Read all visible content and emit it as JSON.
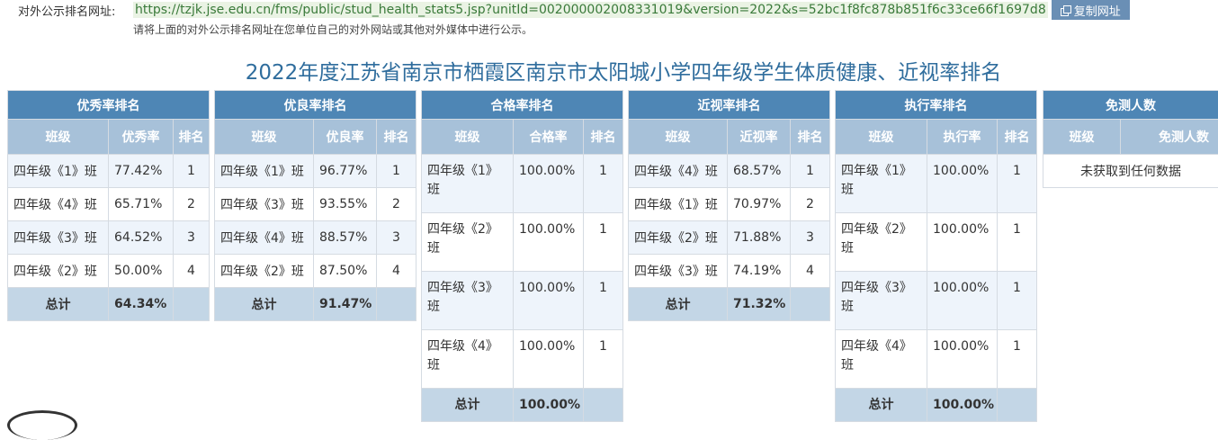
{
  "url_row": {
    "label": "对外公示排名网址:",
    "url": "https://tzjk.jse.edu.cn/fms/public/stud_health_stats5.jsp?unitId=002000002008331019&version=2022&s=52bc1f8fc878b851f6c33ce66f1697d8",
    "copy_button": "复制网址",
    "hint": "请将上面的对外公示排名网址在您单位自己的对外网站或其他对外媒体中进行公示。"
  },
  "title": "2022年度江苏省南京市栖霞区南京市太阳城小学四年级学生体质健康、近视率排名",
  "tables": {
    "excellent": {
      "caption": "优秀率排名",
      "headers": [
        "班级",
        "优秀率",
        "排名"
      ],
      "rows": [
        [
          "四年级《1》班",
          "77.42%",
          "1"
        ],
        [
          "四年级《4》班",
          "65.71%",
          "2"
        ],
        [
          "四年级《3》班",
          "64.52%",
          "3"
        ],
        [
          "四年级《2》班",
          "50.00%",
          "4"
        ]
      ],
      "total_label": "总计",
      "total_value": "64.34%"
    },
    "good": {
      "caption": "优良率排名",
      "headers": [
        "班级",
        "优良率",
        "排名"
      ],
      "rows": [
        [
          "四年级《1》班",
          "96.77%",
          "1"
        ],
        [
          "四年级《3》班",
          "93.55%",
          "2"
        ],
        [
          "四年级《4》班",
          "88.57%",
          "3"
        ],
        [
          "四年级《2》班",
          "87.50%",
          "4"
        ]
      ],
      "total_label": "总计",
      "total_value": "91.47%"
    },
    "pass": {
      "caption": "合格率排名",
      "headers": [
        "班级",
        "合格率",
        "排名"
      ],
      "rows": [
        [
          "四年级《1》班",
          "100.00%",
          "1"
        ],
        [
          "四年级《2》班",
          "100.00%",
          "1"
        ],
        [
          "四年级《3》班",
          "100.00%",
          "1"
        ],
        [
          "四年级《4》班",
          "100.00%",
          "1"
        ]
      ],
      "total_label": "总计",
      "total_value": "100.00%"
    },
    "myopia": {
      "caption": "近视率排名",
      "headers": [
        "班级",
        "近视率",
        "排名"
      ],
      "rows": [
        [
          "四年级《4》班",
          "68.57%",
          "1"
        ],
        [
          "四年级《1》班",
          "70.97%",
          "2"
        ],
        [
          "四年级《2》班",
          "71.88%",
          "3"
        ],
        [
          "四年级《3》班",
          "74.19%",
          "4"
        ]
      ],
      "total_label": "总计",
      "total_value": "71.32%"
    },
    "execution": {
      "caption": "执行率排名",
      "headers": [
        "班级",
        "执行率",
        "排名"
      ],
      "rows": [
        [
          "四年级《1》班",
          "100.00%",
          "1"
        ],
        [
          "四年级《2》班",
          "100.00%",
          "1"
        ],
        [
          "四年级《3》班",
          "100.00%",
          "1"
        ],
        [
          "四年级《4》班",
          "100.00%",
          "1"
        ]
      ],
      "total_label": "总计",
      "total_value": "100.00%"
    },
    "exempt": {
      "caption": "免测人数",
      "headers": [
        "班级",
        "免测人数"
      ],
      "empty_text": "未获取到任何数据"
    }
  },
  "colors": {
    "caption_bg": "#4e86b5",
    "header_bg": "#a7c1d9",
    "total_bg": "#c3d6e6",
    "title_color": "#2f6d9d",
    "url_bg": "#eaf3e4"
  }
}
